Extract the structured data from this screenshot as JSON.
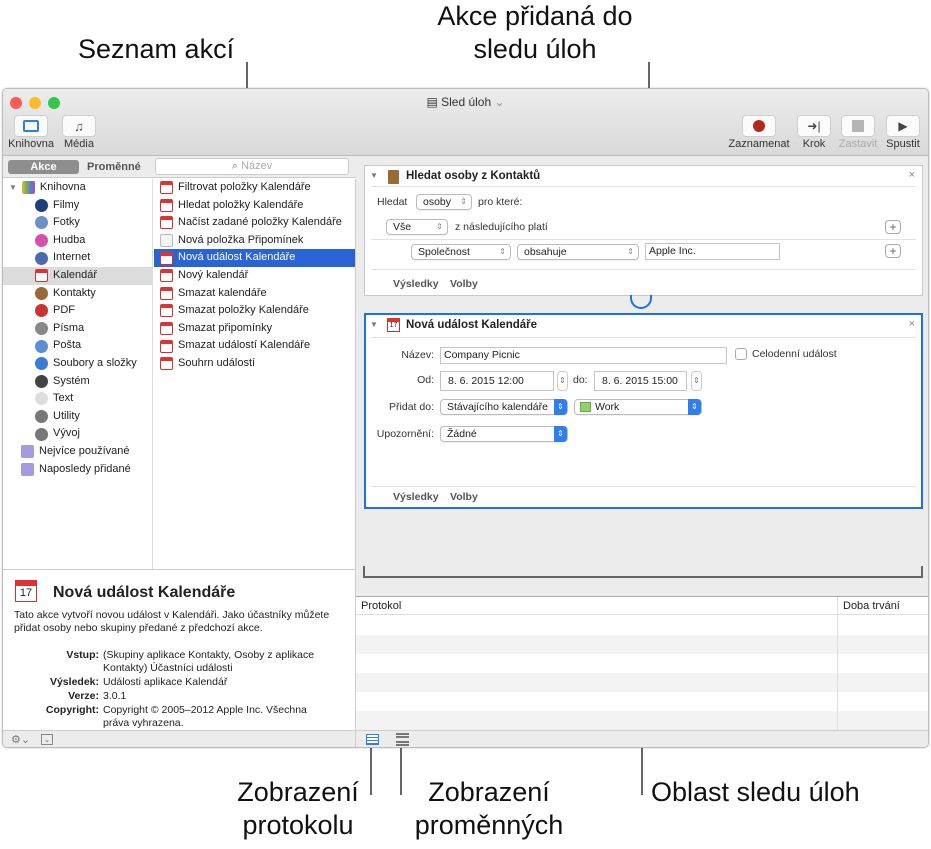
{
  "callouts": {
    "action_list": "Seznam akcí",
    "added_action_1": "Akce přidaná do",
    "added_action_2": "sledu úloh",
    "log_view_1": "Zobrazení",
    "log_view_2": "protokolu",
    "variables_view_1": "Zobrazení",
    "variables_view_2": "proměnných",
    "workflow_area": "Oblast sledu úloh"
  },
  "window": {
    "title": "Sled úloh"
  },
  "toolbar": {
    "library": "Knihovna",
    "media": "Média",
    "record": "Zaznamenat",
    "step": "Krok",
    "stop": "Zastavit",
    "run": "Spustit"
  },
  "tabs": {
    "actions": "Akce",
    "variables": "Proměnné"
  },
  "search": {
    "placeholder": "Název"
  },
  "library": {
    "root": "Knihovna",
    "items": [
      "Filmy",
      "Fotky",
      "Hudba",
      "Internet",
      "Kalendář",
      "Kontakty",
      "PDF",
      "Písma",
      "Pošta",
      "Soubory a složky",
      "Systém",
      "Text",
      "Utility",
      "Vývoj"
    ],
    "selected": "Kalendář",
    "smart": [
      "Nejvíce používané",
      "Naposledy přidané"
    ]
  },
  "actions": {
    "items": [
      "Filtrovat položky Kalendáře",
      "Hledat položky Kalendáře",
      "Načíst zadané položky Kalendáře",
      "Nová položka Připomínek",
      "Nová událost Kalendáře",
      "Nový kalendář",
      "Smazat kalendáře",
      "Smazat položky Kalendáře",
      "Smazat připomínky",
      "Smazat událostí Kalendáře",
      "Souhrn událostí"
    ],
    "selected": "Nová událost Kalendáře"
  },
  "description": {
    "title": "Nová událost Kalendáře",
    "text": "Tato akce vytvoří novou událost v Kalendáři. Jako účastníky můžete přidat osoby nebo skupiny předané z předchozí akce.",
    "fields": [
      {
        "label": "Vstup:",
        "value": "(Skupiny aplikace Kontakty, Osoby z aplikace Kontakty) Účastníci události"
      },
      {
        "label": "Výsledek:",
        "value": "Události aplikace Kalendář"
      },
      {
        "label": "Verze:",
        "value": "3.0.1"
      },
      {
        "label": "Copyright:",
        "value": "Copyright © 2005–2012 Apple Inc. Všechna práva vyhrazena."
      }
    ]
  },
  "card1": {
    "title": "Hledat osoby z Kontaktů",
    "find_label": "Hledat",
    "find_value": "osoby",
    "for_which": "pro které:",
    "match_value": "Vše",
    "match_text": "z následujícího platí",
    "field": "Společnost",
    "operator": "obsahuje",
    "value": "Apple Inc.",
    "results": "Výsledky",
    "options": "Volby"
  },
  "card2": {
    "title": "Nová událost Kalendáře",
    "name_label": "Název:",
    "name_value": "Company Picnic",
    "allday": "Celodenní událost",
    "allday_checked": false,
    "from_label": "Od:",
    "from_value": "8.   6. 2015 12:00",
    "to_label": "do:",
    "to_value": "8.   6. 2015 15:00",
    "add_label": "Přidat do:",
    "add_value": "Stávajícího kalendáře",
    "calendar": "Work",
    "calendar_color": "#8fd16a",
    "alert_label": "Upozornění:",
    "alert_value": "Žádné",
    "results": "Výsledky",
    "options": "Volby"
  },
  "log": {
    "col1": "Protokol",
    "col2": "Doba trvání"
  },
  "colors": {
    "selection": "#2a64d4",
    "accent": "#1a73e0",
    "record": "#b3271e"
  }
}
